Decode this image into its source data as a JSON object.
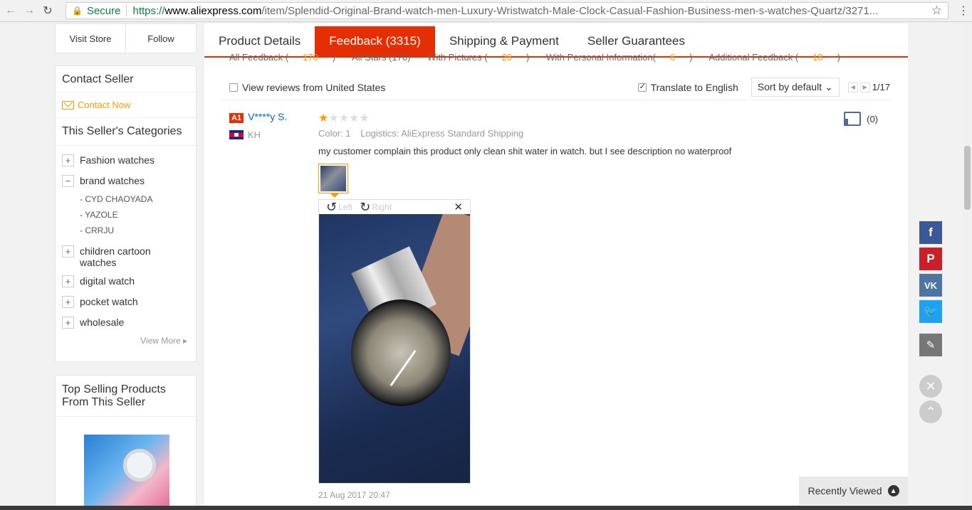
{
  "browser": {
    "secure_label": "Secure",
    "url_scheme": "https://",
    "url_host": "www.aliexpress.com",
    "url_rest": "/item/Splendid-Original-Brand-watch-men-Luxury-Wristwatch-Male-Clock-Casual-Fashion-Business-men-s-watches-Quartz/3271..."
  },
  "store": {
    "visit": "Visit Store",
    "follow": "Follow"
  },
  "contact": {
    "title": "Contact Seller",
    "link": "Contact Now"
  },
  "categories": {
    "title": "This Seller's Categories",
    "items": [
      {
        "sign": "+",
        "label": "Fashion watches"
      },
      {
        "sign": "−",
        "label": "brand watches"
      },
      {
        "sign": "+",
        "label": "children cartoon watches"
      },
      {
        "sign": "+",
        "label": "digital watch"
      },
      {
        "sign": "+",
        "label": "pocket watch"
      },
      {
        "sign": "+",
        "label": "wholesale"
      }
    ],
    "sub_items": [
      "- CYD CHAOYADA",
      "- YAZOLE",
      "- CRRJU"
    ],
    "view_more": "View More"
  },
  "top_selling": {
    "title": "Top Selling Products From This Seller"
  },
  "tabs": [
    "Product Details",
    "Feedback (3315)",
    "Shipping & Payment",
    "Seller Guarantees"
  ],
  "filters": {
    "all_feedback": "All Feedback (",
    "all_feedback_count": "170",
    "all_stars": "All Stars (170)",
    "with_pictures": "With Pictures (",
    "with_pictures_count": "26",
    "personal_info": "With Personal Information(",
    "personal_info_count": "6",
    "additional": "Additional Feedback (",
    "additional_count": "18"
  },
  "review_bar": {
    "view_us": "View reviews from United States",
    "translate": "Translate to English",
    "sort": "Sort by default",
    "page": "1/17"
  },
  "review": {
    "badge": "A1",
    "user": "V****y S.",
    "country": "KH",
    "rating": 1,
    "color_label": "Color: 1",
    "logistics_label": "Logistics: AliExpress Standard Shipping",
    "comment": "my customer complain this product only clean shit water in watch. but I see description no waterproof",
    "rotate_left": "Left",
    "rotate_right": "Right",
    "date": "21 Aug 2017 20:47",
    "helpful": "(0)"
  },
  "recently_viewed": "Recently Viewed",
  "colors": {
    "accent": "#e62e04",
    "link": "#0066cc",
    "orange": "#ff9900"
  }
}
